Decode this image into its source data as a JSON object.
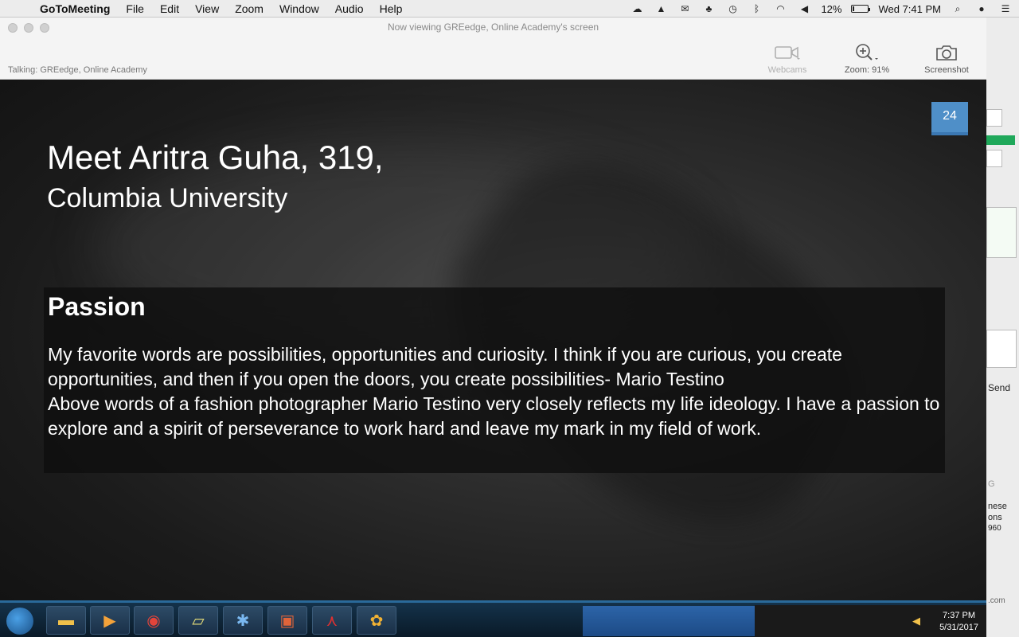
{
  "menubar": {
    "app_name": "GoToMeeting",
    "menus": [
      "File",
      "Edit",
      "View",
      "Zoom",
      "Window",
      "Audio",
      "Help"
    ],
    "battery_text": "12%",
    "battery_level": 0.12,
    "clock": "Wed 7:41 PM"
  },
  "window": {
    "title": "Now viewing GREedge, Online Academy's screen",
    "talking": "Talking: GREedge, Online Academy",
    "tools": {
      "webcams": "Webcams",
      "zoom": "Zoom: 91%",
      "screenshot": "Screenshot"
    }
  },
  "slide": {
    "number": "24",
    "title": "Meet Aritra Guha, 319,",
    "subtitle": "Columbia University",
    "section_heading": "Passion",
    "body_line1": "My favorite words are possibilities, opportunities and curiosity. I think if you are curious, you create opportunities, and then if you open the doors, you create possibilities- Mario Testino",
    "body_line2": "Above words of a fashion photographer Mario Testino very closely reflects my  life ideology. I have a passion to explore and a spirit of perseverance to work hard and leave my mark in my field of work."
  },
  "taskbar": {
    "time": "7:37 PM",
    "date": "5/31/2017"
  },
  "background_window": {
    "send_label": "Send",
    "fragment1": "nese",
    "fragment2": "ons",
    "fragment3": "960",
    "fragment4": ".com",
    "fragment5": "G"
  }
}
